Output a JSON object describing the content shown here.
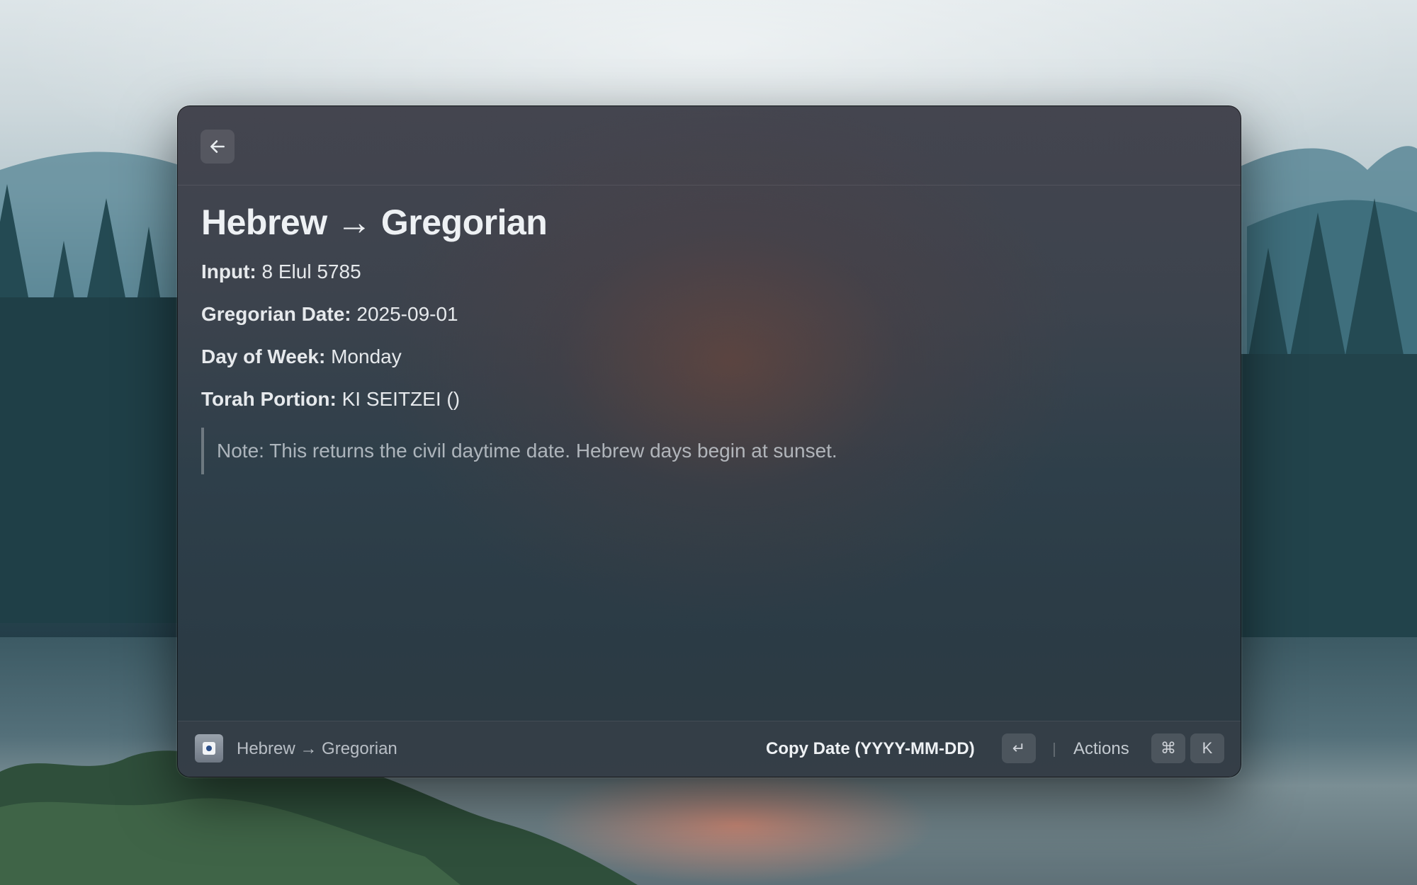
{
  "window": {
    "title": "Hebrew → Gregorian",
    "back_icon": "arrow-left-icon"
  },
  "details": {
    "input_key": "Input:",
    "input_value": "8 Elul 5785",
    "gregorian_key": "Gregorian Date:",
    "gregorian_value": "2025-09-01",
    "weekday_key": "Day of Week:",
    "weekday_value": "Monday",
    "torah_key": "Torah Portion:",
    "torah_value": "KI SEITZEI ()",
    "note": "Note: This returns the civil daytime date. Hebrew days begin at sunset."
  },
  "footer": {
    "command_title": "Hebrew → Gregorian",
    "primary_action": "Copy Date (YYYY-MM-DD)",
    "enter_key": "↵",
    "actions_label": "Actions",
    "cmd_key": "⌘",
    "k_key": "K"
  },
  "colors": {
    "window_bg": "#3a424c",
    "text_primary": "#eef1f4",
    "text_secondary": "#aeb6be"
  }
}
